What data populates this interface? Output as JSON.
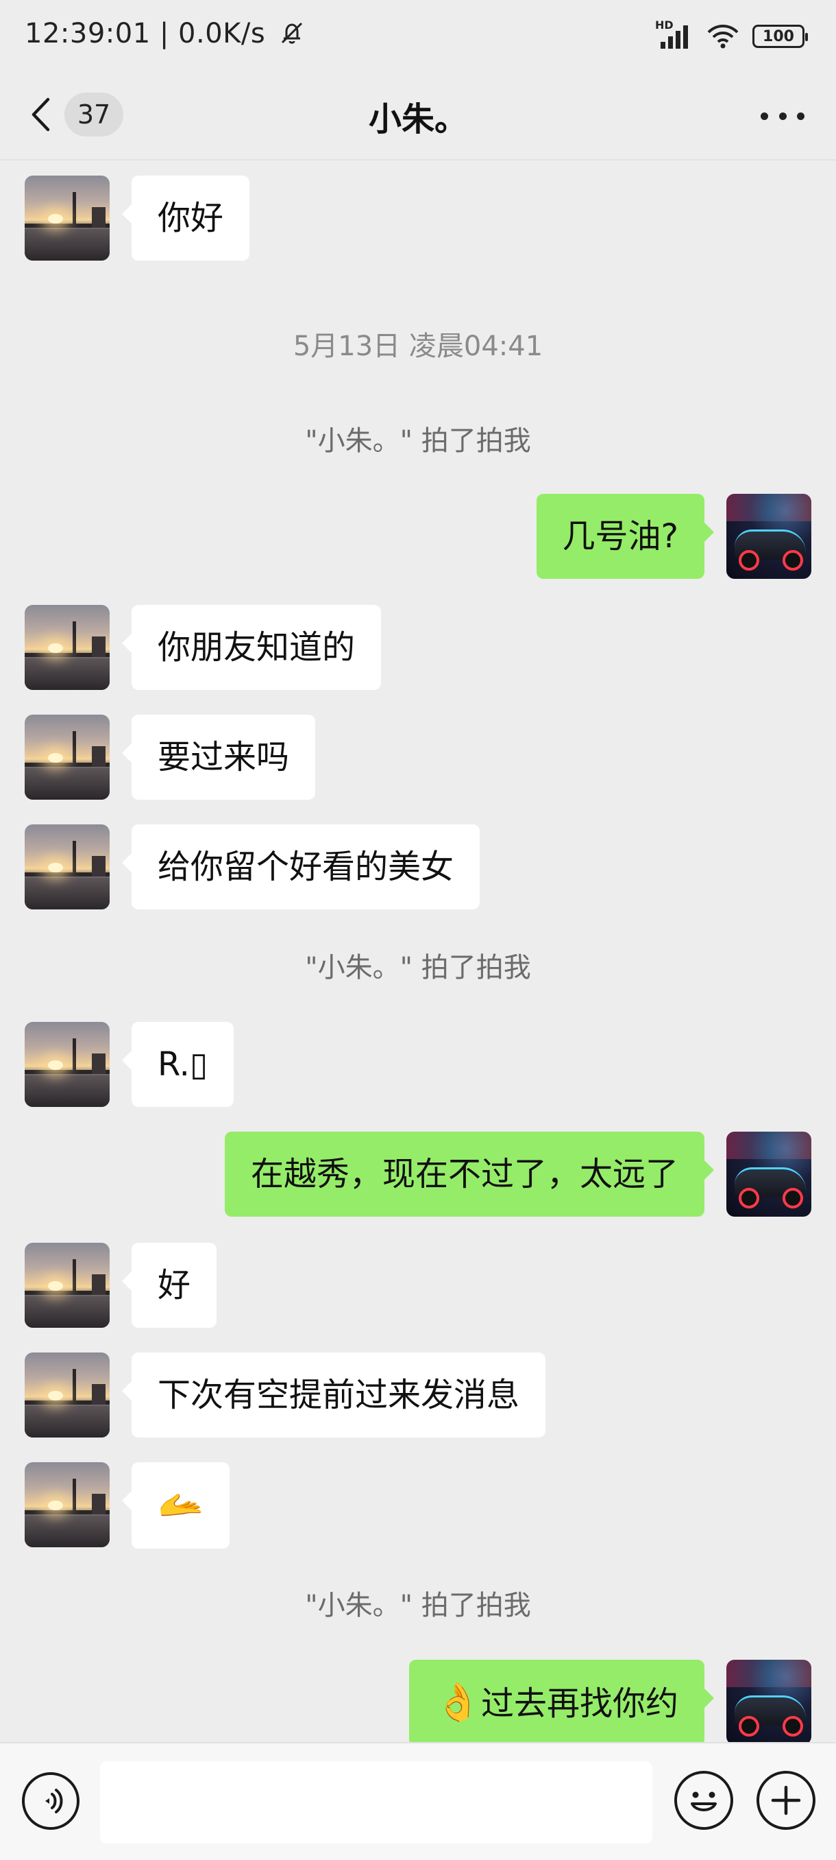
{
  "status_bar": {
    "time": "12:39:01 | 0.0K/s",
    "network_label": "HD",
    "battery": "100"
  },
  "header": {
    "back_count": "37",
    "title": "小朱。"
  },
  "messages": [
    {
      "type": "text",
      "side": "in",
      "text": "你好"
    },
    {
      "type": "time",
      "text": "5月13日 凌晨04:41"
    },
    {
      "type": "pat",
      "text": "\"小朱。\" 拍了拍我"
    },
    {
      "type": "text",
      "side": "out",
      "text": "几号油?"
    },
    {
      "type": "text",
      "side": "in",
      "text": "你朋友知道的"
    },
    {
      "type": "text",
      "side": "in",
      "text": "要过来吗"
    },
    {
      "type": "text",
      "side": "in",
      "text": "给你留个好看的美女"
    },
    {
      "type": "pat",
      "text": "\"小朱。\" 拍了拍我"
    },
    {
      "type": "text",
      "side": "in",
      "text": "R.▯"
    },
    {
      "type": "text",
      "side": "out",
      "text": "在越秀，现在不过了，太远了"
    },
    {
      "type": "text",
      "side": "in",
      "text": "好"
    },
    {
      "type": "text",
      "side": "in",
      "text": "下次有空提前过来发消息"
    },
    {
      "type": "emoji",
      "side": "in",
      "text": "🫴"
    },
    {
      "type": "pat",
      "text": "\"小朱。\" 拍了拍我"
    },
    {
      "type": "text",
      "side": "out",
      "emoji": "👌",
      "text": "过去再找你约"
    }
  ],
  "input_bar": {
    "placeholder": ""
  },
  "colors": {
    "background": "#ededed",
    "incoming_bubble": "#ffffff",
    "outgoing_bubble": "#95ec69"
  }
}
